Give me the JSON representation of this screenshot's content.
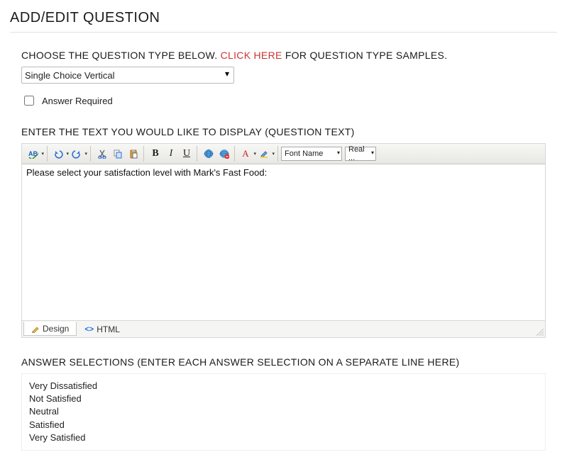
{
  "header": {
    "page_title": "ADD/EDIT QUESTION"
  },
  "type_section": {
    "prompt_pre": "CHOOSE THE QUESTION TYPE BELOW. ",
    "link_text": "CLICK HERE",
    "prompt_post": " FOR QUESTION TYPE SAMPLES.",
    "selected_type": "Single Choice Vertical",
    "answer_required_label": "Answer Required",
    "answer_required_checked": false
  },
  "rte": {
    "section_label": "ENTER THE TEXT YOU WOULD LIKE TO DISPLAY (QUESTION TEXT)",
    "content": "Please select your satisfaction level with Mark's Fast Food:",
    "font_name_label": "Font Name",
    "font_size_label": "Real ...",
    "tabs": {
      "design": "Design",
      "html": "HTML"
    }
  },
  "answers": {
    "section_label": "ANSWER SELECTIONS (ENTER EACH ANSWER SELECTION ON A SEPARATE LINE HERE)",
    "lines": [
      "Very Dissatisfied",
      "Not Satisfied",
      "Neutral",
      "Satisfied",
      "Very Satisfied"
    ]
  }
}
